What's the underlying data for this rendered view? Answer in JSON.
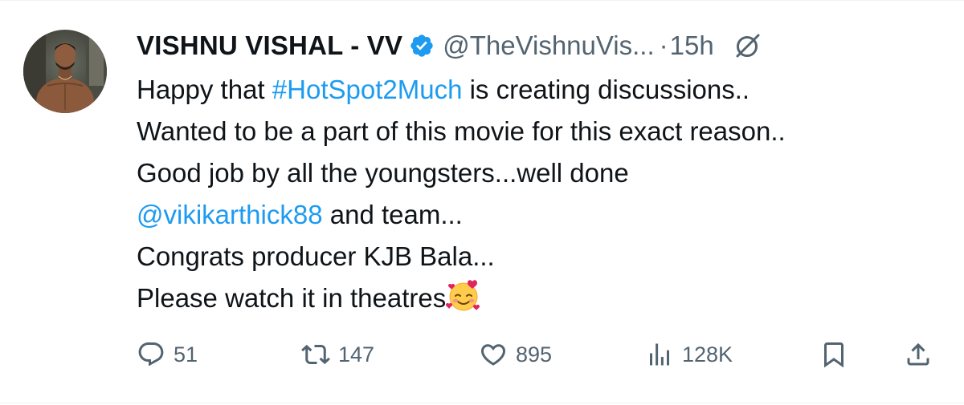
{
  "tweet": {
    "author_name": "VISHNU VISHAL - VV",
    "handle": "@TheVishnuVis...",
    "separator": "·",
    "time": "15h",
    "lines": [
      {
        "pre": "Happy that ",
        "link": "#HotSpot2Much",
        "post": " is creating discussions.."
      },
      {
        "pre": "Wanted to be a part of this movie for this exact reason..",
        "link": "",
        "post": ""
      },
      {
        "pre": "Good job by all the youngsters...well done",
        "link": "",
        "post": ""
      },
      {
        "pre": "",
        "link": "@vikikarthick88",
        "post": " and team..."
      },
      {
        "pre": "Congrats producer KJB Bala...",
        "link": "",
        "post": ""
      },
      {
        "pre": "Please watch it in theatres",
        "link": "",
        "post": ""
      }
    ],
    "emoji": "smiling-face-with-hearts"
  },
  "actions": {
    "replies": "51",
    "reposts": "147",
    "likes": "895",
    "views": "128K"
  },
  "colors": {
    "link": "#1d9bf0",
    "muted": "#536471",
    "text": "#0f1419",
    "verified": "#1d9bf0"
  },
  "icons": {
    "verified": "verified-badge-icon",
    "grok": "grok-icon",
    "reply": "reply-icon",
    "repost": "repost-icon",
    "like": "like-icon",
    "views": "views-icon",
    "bookmark": "bookmark-icon",
    "share": "share-icon"
  }
}
